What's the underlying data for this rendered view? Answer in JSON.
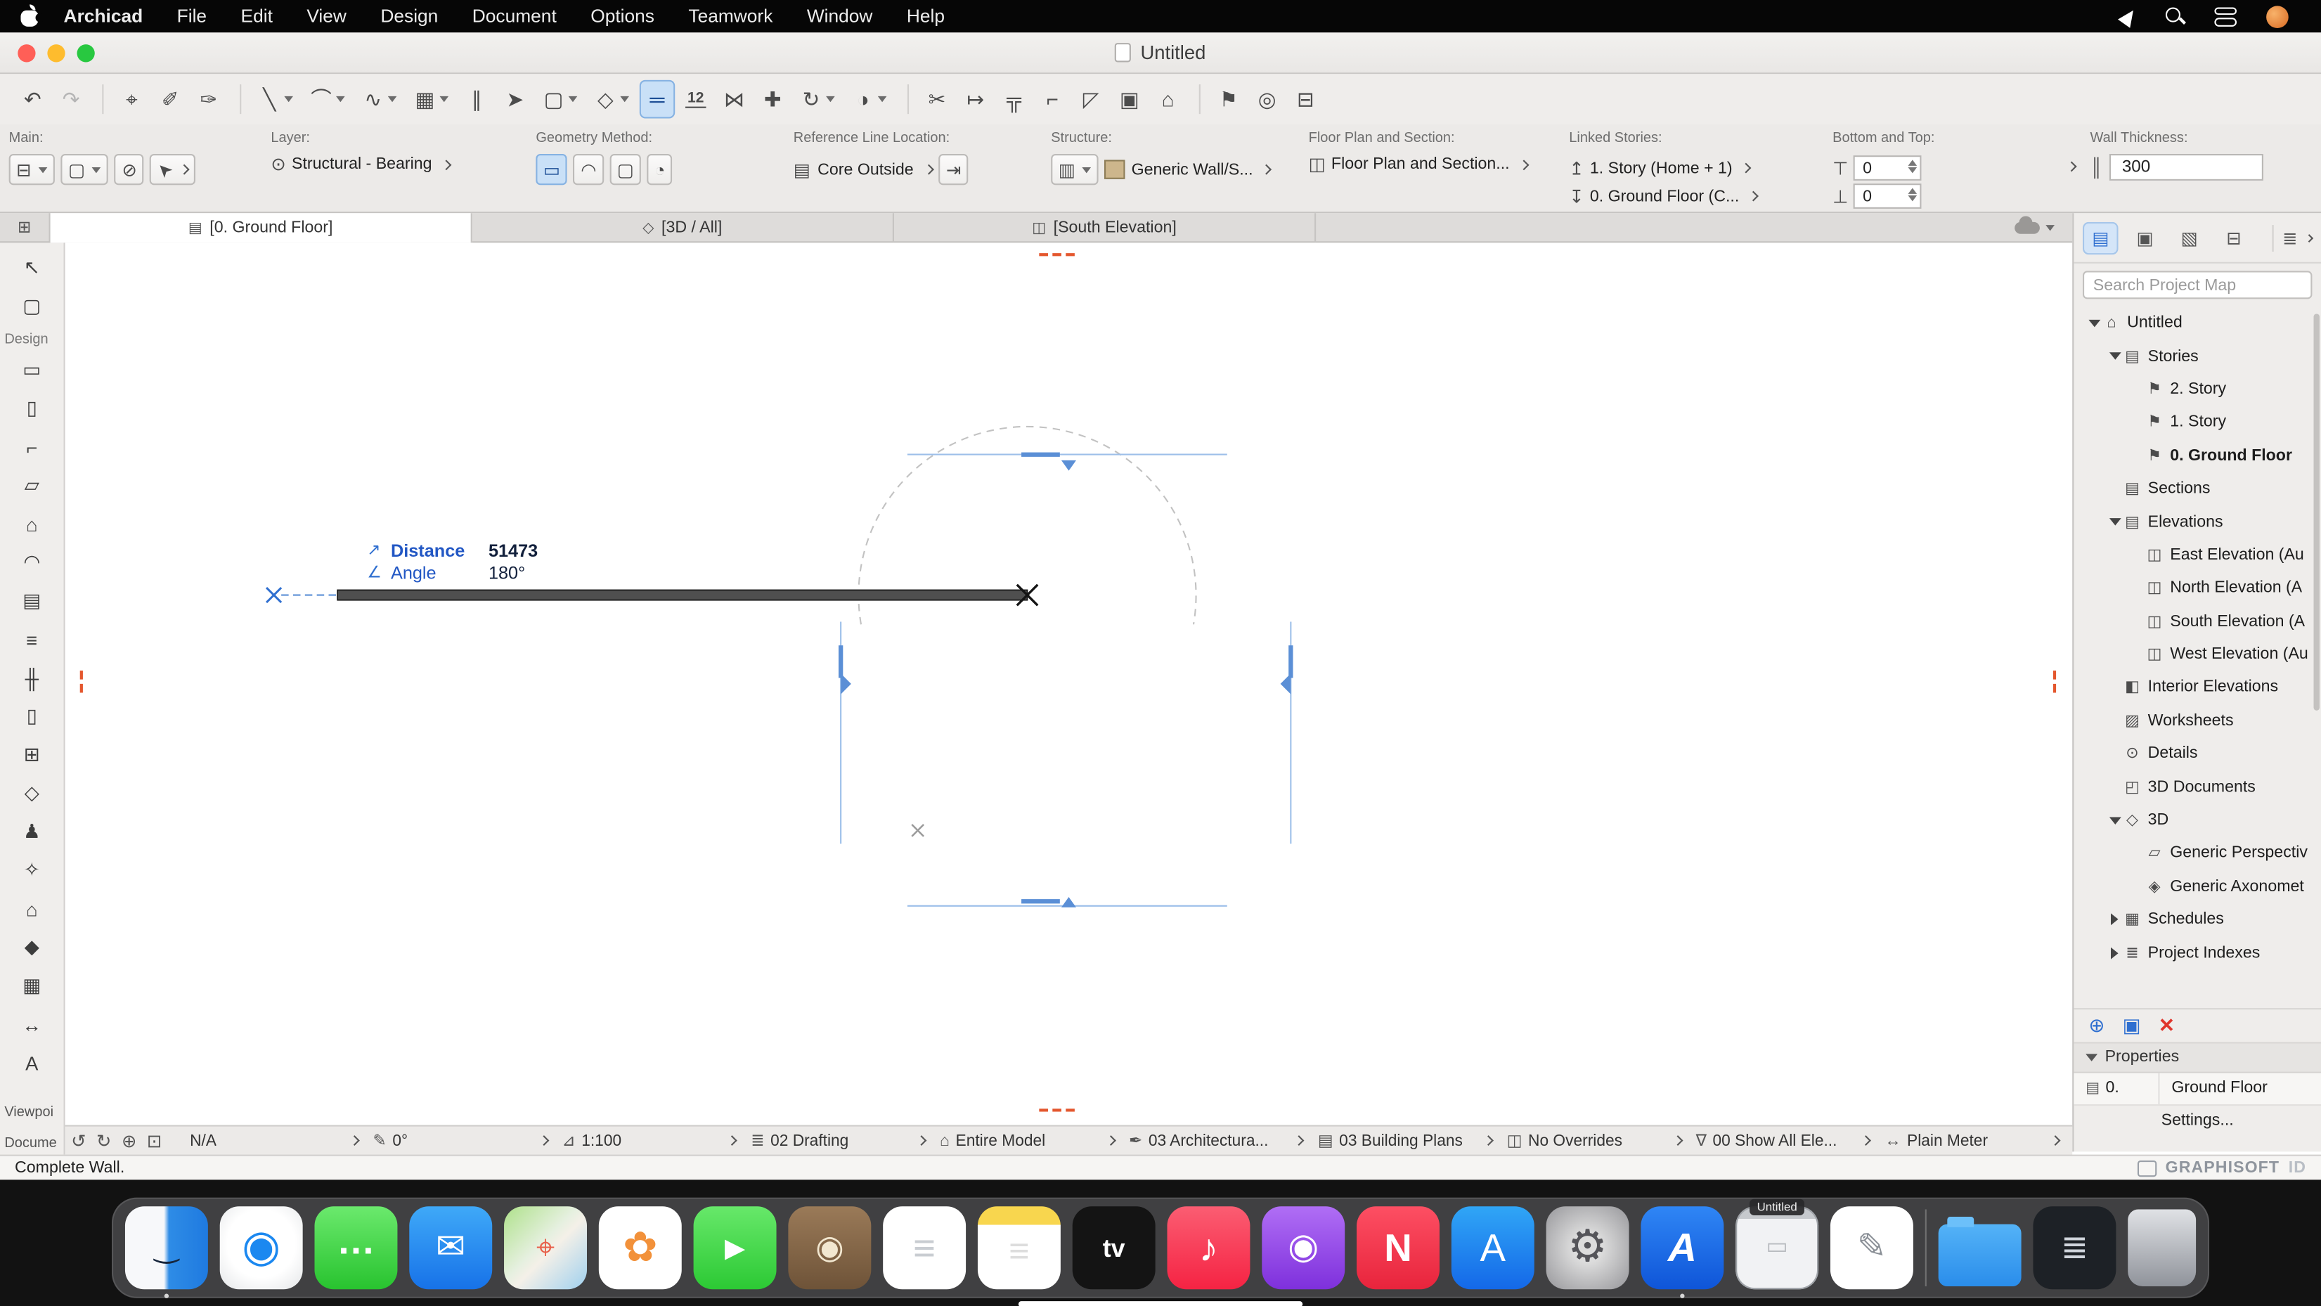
{
  "menubar": {
    "app_name": "Archicad",
    "items": [
      "File",
      "Edit",
      "View",
      "Design",
      "Document",
      "Options",
      "Teamwork",
      "Window",
      "Help"
    ]
  },
  "window": {
    "title": "Untitled"
  },
  "toolbar": {
    "items": [
      {
        "type": "icon",
        "glyph": "↶",
        "name": "undo-icon"
      },
      {
        "type": "icon",
        "glyph": "↷",
        "name": "redo-icon",
        "state": "disabled"
      },
      {
        "type": "sep",
        "name": "toolbar-separator"
      },
      {
        "type": "icon",
        "glyph": "⌖",
        "name": "find-select-icon"
      },
      {
        "type": "icon",
        "glyph": "✐",
        "name": "pick-up-parameters-icon"
      },
      {
        "type": "icon",
        "glyph": "✑",
        "name": "inject-parameters-icon"
      },
      {
        "type": "sep",
        "name": "toolbar-separator"
      },
      {
        "type": "combo",
        "glyph": "╲",
        "name": "line-tool-combo"
      },
      {
        "type": "combo",
        "glyph": "⌒",
        "name": "arc-tool-combo"
      },
      {
        "type": "combo",
        "glyph": "∿",
        "name": "spline-tool-combo"
      },
      {
        "type": "combo",
        "glyph": "▦",
        "name": "grid-snap-combo"
      },
      {
        "type": "icon",
        "glyph": "∥",
        "name": "guide-lines-icon"
      },
      {
        "type": "icon",
        "glyph": "➤",
        "name": "cursor-snap-icon"
      },
      {
        "type": "combo",
        "glyph": "▢",
        "name": "marquee-combo"
      },
      {
        "type": "combo",
        "glyph": "◇",
        "name": "group-lock-combo"
      },
      {
        "type": "icon",
        "glyph": "═",
        "name": "wall-tool-icon",
        "state": "selected"
      },
      {
        "type": "icon",
        "glyph": "12",
        "name": "dimension-icon"
      },
      {
        "type": "icon",
        "glyph": "⋈",
        "name": "stretch-icon"
      },
      {
        "type": "icon",
        "glyph": "✚",
        "name": "drag-icon"
      },
      {
        "type": "combo",
        "glyph": "↻",
        "name": "rotate-combo"
      },
      {
        "type": "combo",
        "glyph": "◑",
        "name": "mirror-combo"
      },
      {
        "type": "sep",
        "name": "toolbar-separator"
      },
      {
        "type": "icon",
        "glyph": "✂",
        "name": "trim-icon"
      },
      {
        "type": "icon",
        "glyph": "↦",
        "name": "adjust-icon"
      },
      {
        "type": "icon",
        "glyph": "╦",
        "name": "intersect-icon"
      },
      {
        "type": "icon",
        "glyph": "⌐",
        "name": "fillet-icon"
      },
      {
        "type": "icon",
        "glyph": "◸",
        "name": "resize-icon"
      },
      {
        "type": "icon",
        "glyph": "▣",
        "name": "multiply-icon"
      },
      {
        "type": "icon",
        "glyph": "⌂",
        "name": "elevation-marker-icon"
      },
      {
        "type": "sep",
        "name": "toolbar-separator"
      },
      {
        "type": "icon",
        "glyph": "⚑",
        "name": "marker-icon"
      },
      {
        "type": "icon",
        "glyph": "◎",
        "name": "detail-icon"
      },
      {
        "type": "icon",
        "glyph": "⊟",
        "name": "worksheet-icon"
      }
    ]
  },
  "infobox": {
    "main": {
      "label": "Main:",
      "combo1_icon": "⊟",
      "combo2_icon": "▢",
      "noparam_icon": "⊘",
      "arrow_icon": "➤"
    },
    "layer": {
      "label": "Layer:",
      "eye_icon": "⊙",
      "value": "Structural - Bearing"
    },
    "geometry": {
      "label": "Geometry Method:",
      "chips": [
        {
          "glyph": "▭",
          "name": "straight-wall-chip",
          "state": "selected",
          "type": "combo"
        },
        {
          "glyph": "◠",
          "name": "curved-wall-chip",
          "type": "combo"
        },
        {
          "glyph": "▢",
          "name": "chained-wall-chip",
          "type": "icon"
        },
        {
          "glyph": "◔",
          "name": "rectangular-wall-chip",
          "type": "combo"
        }
      ]
    },
    "refline": {
      "label": "Reference Line Location:",
      "icon": "▤",
      "value": "Core Outside",
      "flip_icon": "⇥"
    },
    "structure": {
      "label": "Structure:",
      "icon": "▥",
      "value": "Generic Wall/S...",
      "swatch": "#cdb68c"
    },
    "floorplan": {
      "label": "Floor Plan and Section:",
      "icon": "◫",
      "value": "Floor Plan and Section..."
    },
    "linked": {
      "label": "Linked Stories:",
      "rows": [
        {
          "glyph": "↥",
          "label": "1. Story (Home + 1)",
          "name": "top-link-row"
        },
        {
          "glyph": "↧",
          "label": "0. Ground Floor (C...",
          "name": "bottom-link-row"
        }
      ]
    },
    "bottomtop": {
      "label": "Bottom and Top:",
      "rows": [
        {
          "glyph": "⊤",
          "value": "0",
          "name": "top-offset-row"
        },
        {
          "glyph": "⊥",
          "value": "0",
          "name": "bottom-offset-row"
        }
      ]
    },
    "thickness": {
      "label": "Wall Thickness:",
      "icon": "║",
      "value": "300"
    }
  },
  "tabbar": {
    "tabs": [
      {
        "label": "[0. Ground Floor]",
        "icon": "story-tab",
        "state": "active",
        "name": "tab-ground-floor"
      },
      {
        "label": "[3D / All]",
        "icon": "cube",
        "name": "tab-3d-all"
      },
      {
        "label": "[South Elevation]",
        "icon": "elevation",
        "name": "tab-south-elevation"
      }
    ]
  },
  "left_toolbar": {
    "select_tools": [
      {
        "glyph": "↖",
        "name": "arrow-tool"
      },
      {
        "glyph": "▢",
        "name": "marquee-tool"
      }
    ],
    "section_label": "Design",
    "design_tools": [
      {
        "glyph": "▭",
        "name": "wall-tool"
      },
      {
        "glyph": "▯",
        "name": "column-tool"
      },
      {
        "glyph": "⌐",
        "name": "beam-tool"
      },
      {
        "glyph": "▱",
        "name": "slab-tool"
      },
      {
        "glyph": "⌂",
        "name": "roof-tool"
      },
      {
        "glyph": "◠",
        "name": "shell-tool"
      },
      {
        "glyph": "▤",
        "name": "curtain-wall-tool"
      },
      {
        "glyph": "≡",
        "name": "stair-tool"
      },
      {
        "glyph": "╫",
        "name": "railing-tool"
      },
      {
        "glyph": "▯",
        "name": "door-tool"
      },
      {
        "glyph": "⊞",
        "name": "window-tool"
      },
      {
        "glyph": "◇",
        "name": "skylight-tool"
      },
      {
        "glyph": "♟",
        "name": "object-tool"
      },
      {
        "glyph": "✧",
        "name": "lamp-tool"
      },
      {
        "glyph": "⌂",
        "name": "zone-tool"
      },
      {
        "glyph": "◆",
        "name": "morph-tool"
      },
      {
        "glyph": "▦",
        "name": "mesh-tool"
      },
      {
        "glyph": "↔",
        "name": "dimension-tool"
      },
      {
        "glyph": "A",
        "name": "text-tool"
      }
    ],
    "viewpoint_label": "Viewpoi",
    "document_label": "Docume"
  },
  "canvas": {
    "tracker": {
      "distance_icon": "↗",
      "distance_label": "Distance",
      "distance_value": "51473",
      "angle_icon": "∠",
      "angle_label": "Angle",
      "angle_value": "180°"
    }
  },
  "navigator": {
    "header_icons": [
      {
        "glyph": "▤",
        "name": "project-map-icon",
        "state": "selected"
      },
      {
        "glyph": "▣",
        "name": "view-map-icon"
      },
      {
        "glyph": "▧",
        "name": "layout-book-icon"
      },
      {
        "glyph": "⊟",
        "name": "publisher-icon"
      }
    ],
    "organizer_icon": "≣",
    "search_placeholder": "Search Project Map",
    "tree": [
      {
        "label": "Untitled",
        "depth": "0",
        "icon": "project",
        "chev": "down"
      },
      {
        "label": "Stories",
        "depth": "1",
        "icon": "folder",
        "chev": "down"
      },
      {
        "label": "2. Story",
        "depth": "2",
        "icon": "story",
        "chev": "none"
      },
      {
        "label": "1. Story",
        "depth": "2",
        "icon": "story",
        "chev": "none"
      },
      {
        "label": "0. Ground Floor",
        "depth": "2",
        "icon": "story",
        "chev": "none",
        "state": "selected"
      },
      {
        "label": "Sections",
        "depth": "1",
        "icon": "folder",
        "chev": "none"
      },
      {
        "label": "Elevations",
        "depth": "1",
        "icon": "folder",
        "chev": "down"
      },
      {
        "label": "East Elevation (Au",
        "depth": "2",
        "icon": "elevation",
        "chev": "none"
      },
      {
        "label": "North Elevation (A",
        "depth": "2",
        "icon": "elevation",
        "chev": "none"
      },
      {
        "label": "South Elevation (A",
        "depth": "2",
        "icon": "elevation",
        "chev": "none"
      },
      {
        "label": "West Elevation (Au",
        "depth": "2",
        "icon": "elevation",
        "chev": "none"
      },
      {
        "label": "Interior Elevations",
        "depth": "1",
        "icon": "interior-elevation",
        "chev": "none"
      },
      {
        "label": "Worksheets",
        "depth": "1",
        "icon": "worksheet",
        "chev": "none"
      },
      {
        "label": "Details",
        "depth": "1",
        "icon": "detail",
        "chev": "none"
      },
      {
        "label": "3D Documents",
        "depth": "1",
        "icon": "document-3d",
        "chev": "none"
      },
      {
        "label": "3D",
        "depth": "1",
        "icon": "three-d",
        "chev": "down"
      },
      {
        "label": "Generic Perspectiv",
        "depth": "2",
        "icon": "perspective",
        "chev": "none"
      },
      {
        "label": "Generic Axonomet",
        "depth": "2",
        "icon": "axonometry",
        "chev": "none"
      },
      {
        "label": "Schedules",
        "depth": "1",
        "icon": "schedule",
        "chev": "right"
      },
      {
        "label": "Project Indexes",
        "depth": "1",
        "icon": "index",
        "chev": "right"
      }
    ],
    "actions": [
      {
        "glyph": "⊕",
        "name": "add-viewpoint-button",
        "cls": "blue"
      },
      {
        "glyph": "▣",
        "name": "viewpoint-settings-button",
        "cls": "blue"
      },
      {
        "glyph": "✕",
        "name": "delete-viewpoint-button",
        "cls": "red"
      }
    ],
    "properties": {
      "header": "Properties",
      "key_icon": "▤",
      "row_key": "0.",
      "row_value": "Ground Floor",
      "settings": "Settings..."
    }
  },
  "statusbar": {
    "zoom_icons": [
      {
        "glyph": "↺",
        "name": "zoom-back-icon"
      },
      {
        "glyph": "↻",
        "name": "zoom-forward-icon"
      },
      {
        "glyph": "⊕",
        "name": "zoom-in-icon"
      },
      {
        "glyph": "⊡",
        "name": "fit-in-window-icon"
      }
    ],
    "chips": [
      {
        "glyph": "",
        "label": "N/A",
        "name": "status-na-combo"
      },
      {
        "glyph": "✎",
        "label": "0°",
        "name": "orientation-combo"
      },
      {
        "glyph": "⊿",
        "label": "1:100",
        "name": "scale-combo"
      },
      {
        "glyph": "≣",
        "label": "02 Drafting",
        "name": "layer-combination-combo"
      },
      {
        "glyph": "⌂",
        "label": "Entire Model",
        "name": "partial-structure-combo"
      },
      {
        "glyph": "✒",
        "label": "03 Architectura...",
        "name": "pen-set-combo"
      },
      {
        "glyph": "▤",
        "label": "03 Building Plans",
        "name": "model-view-combo"
      },
      {
        "glyph": "◫",
        "label": "No Overrides",
        "name": "graphic-override-combo"
      },
      {
        "glyph": "∇",
        "label": "00 Show All Ele...",
        "name": "renovation-filter-combo"
      },
      {
        "glyph": "↔",
        "label": "Plain Meter",
        "name": "dimensions-combo"
      }
    ]
  },
  "statusline": {
    "message": "Complete Wall.",
    "brand": "GRAPHISOFT",
    "brand_suffix": "ID"
  },
  "dock": {
    "items": [
      {
        "app": "finder",
        "name": "finder-dock-icon",
        "style": "background:linear-gradient(90deg,#f7f8fa 0%,#f7f8fa 47%,#2e8ce6 53%,#1f7ae0 100%)",
        "glyph": "‿",
        "glyph_style": "color:#16263c;font-size:20px",
        "running": "true"
      },
      {
        "app": "safari",
        "name": "safari-dock-icon",
        "style": "background:radial-gradient(circle at 50% 45%,#ffffff 55%,#e4e6e8 100%)",
        "glyph": "◉",
        "glyph_style": "color:#1b88f0;font-size:30px"
      },
      {
        "app": "messages",
        "name": "messages-dock-icon",
        "style": "background:linear-gradient(180deg,#6be96d,#28c32f)",
        "glyph": "…",
        "glyph_style": "color:#ffffff;font-size:26px;font-weight:bold;margin-top:-10px"
      },
      {
        "app": "mail",
        "name": "mail-dock-icon",
        "style": "background:linear-gradient(180deg,#3fa9f8,#1772e8)",
        "glyph": "✉",
        "glyph_style": "color:#ffffff;font-size:24px"
      },
      {
        "app": "maps",
        "name": "maps-dock-icon",
        "style": "background:linear-gradient(135deg,#aee18a 0%,#e6f0e0 45%,#f4f0e8 55%,#9fd0ee 100%)",
        "glyph": "⌖",
        "glyph_style": "color:#e8604a;font-size:22px"
      },
      {
        "app": "photos",
        "name": "photos-dock-icon",
        "style": "background:#ffffff",
        "glyph": "✿",
        "glyph_style": "color:#f2913a;font-size:28px"
      },
      {
        "app": "facetime",
        "name": "facetime-dock-icon",
        "style": "background:linear-gradient(180deg,#67e86a,#2cc934)",
        "glyph": "▶",
        "glyph_style": "color:#ffffff;font-size:18px"
      },
      {
        "app": "photo-booth",
        "name": "photo-booth-dock-icon",
        "style": "background:linear-gradient(180deg,#9a7a58,#6e5338)",
        "glyph": "◉",
        "glyph_style": "color:#f2e7d0;font-size:22px"
      },
      {
        "app": "reminders",
        "name": "reminders-dock-icon",
        "style": "background:#ffffff",
        "glyph": "≡",
        "glyph_style": "color:#c9cdd2;font-size:26px"
      },
      {
        "app": "notes",
        "name": "notes-dock-icon",
        "style": "background:linear-gradient(180deg,#f8d64e 0%,#f8d64e 22%,#ffffff 22%,#ffffff 100%)",
        "glyph": "≡",
        "glyph_style": "color:#dddddd;font-size:24px;margin-top:6px"
      },
      {
        "app": "tv",
        "name": "tv-dock-icon",
        "style": "background:#141414",
        "glyph": "tv",
        "glyph_style": "color:#ffffff;font-size:17px;font-weight:bold"
      },
      {
        "app": "music",
        "name": "music-dock-icon",
        "style": "background:linear-gradient(180deg,#fb5d72,#f52343)",
        "glyph": "♪",
        "glyph_style": "color:#ffffff;font-size:26px"
      },
      {
        "app": "podcasts",
        "name": "podcasts-dock-icon",
        "style": "background:linear-gradient(180deg,#b06ef5,#7e30dc)",
        "glyph": "◉",
        "glyph_style": "color:#ffffff;font-size:24px"
      },
      {
        "app": "news",
        "name": "news-dock-icon",
        "style": "background:linear-gradient(180deg,#fd4f63,#e8243c)",
        "glyph": "N",
        "glyph_style": "color:#ffffff;font-size:26px;font-weight:bold"
      },
      {
        "app": "app-store",
        "name": "app-store-dock-icon",
        "style": "background:linear-gradient(180deg,#30a6f6,#1468e8)",
        "glyph": "A",
        "glyph_style": "color:#ffffff;font-size:26px"
      },
      {
        "app": "system-settings",
        "name": "system-settings-dock-icon",
        "style": "background:radial-gradient(circle,#dcdcdc 25%,#96969a 100%)",
        "glyph": "⚙",
        "glyph_style": "color:#55555a;font-size:30px"
      },
      {
        "app": "archicad",
        "name": "archicad-dock-icon",
        "style": "background:linear-gradient(180deg,#2f86f5,#0f55d8)",
        "glyph": "A",
        "glyph_style": "color:#ffffff;font-size:27px;font-weight:bold;font-style:italic",
        "running": "true"
      },
      {
        "app": "untitled-window",
        "name": "minimized-untitled-window",
        "style": "background:linear-gradient(180deg,#c6c9cd 0%,#c6c9cd 15%,#f1f2f4 15%,#f1f2f4 100%);box-shadow:inset 0 0 0 1px #9fa3a8",
        "glyph": "▭",
        "glyph_style": "color:#b9bcc0;font-size:16px",
        "badge": "Untitled"
      },
      {
        "app": "textedit",
        "name": "textedit-dock-icon",
        "style": "background:#ffffff",
        "glyph": "✎",
        "glyph_style": "color:#8a8f96;font-size:24px"
      },
      {
        "type": "divider",
        "app": "divider",
        "name": "dock-divider"
      },
      {
        "app": "downloads-folder",
        "name": "downloads-folder-dock-icon",
        "style": "background:linear-gradient(180deg,#54b3f7,#2a8deb);height:42px;border-radius:6px;margin-top:10px",
        "glyph": "",
        "glyph_style": ""
      },
      {
        "app": "document-stack",
        "name": "document-stack-dock-icon",
        "style": "background:#1d2126",
        "glyph": "≣",
        "glyph_style": "color:#d0d5dc;font-size:22px"
      },
      {
        "app": "trash",
        "name": "trash-dock-icon",
        "style": "background:linear-gradient(180deg,rgba(232,234,238,0.95),rgba(152,156,164,0.9));width:46px;height:52px;border-radius:7px 7px 10px 10px",
        "glyph": "",
        "glyph_style": ""
      }
    ]
  }
}
